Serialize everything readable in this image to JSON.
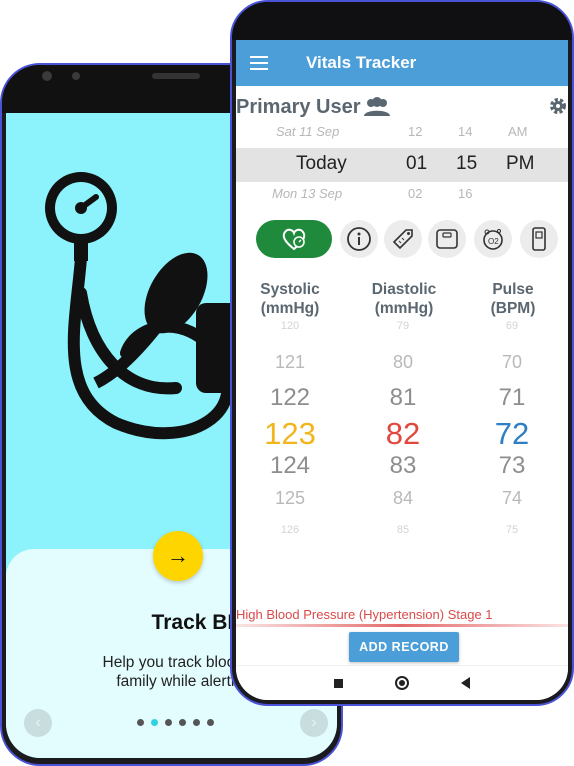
{
  "onboarding": {
    "next_glyph": "→",
    "title": "Track BP",
    "description_line1": "Help you track blood pressure",
    "description_line2": "family while alerting about",
    "prev_glyph": "‹",
    "forward_glyph": "›",
    "page_count": 6,
    "active_page": 2
  },
  "app": {
    "title": "Vitals Tracker",
    "user_name": "Primary User",
    "date_picker": {
      "prev": {
        "day": "Sat 11 Sep",
        "hour": "12",
        "minute": "14",
        "ampm": "AM"
      },
      "selected": {
        "day": "Today",
        "hour": "01",
        "minute": "15",
        "ampm": "PM"
      },
      "next": {
        "day": "Mon 13 Sep",
        "hour": "02",
        "minute": "16"
      }
    },
    "columns": {
      "systolic": {
        "label": "Systolic",
        "unit": "(mmHg)",
        "values": [
          "120",
          "121",
          "122",
          "123",
          "124",
          "125",
          "126"
        ],
        "color": "#f2b51c"
      },
      "diastolic": {
        "label": "Diastolic",
        "unit": "(mmHg)",
        "values": [
          "79",
          "80",
          "81",
          "82",
          "83",
          "84",
          "85"
        ],
        "color": "#e0483c"
      },
      "pulse": {
        "label": "Pulse",
        "unit": "(BPM)",
        "values": [
          "69",
          "70",
          "71",
          "72",
          "73",
          "74",
          "75"
        ],
        "color": "#2f7fc4"
      }
    },
    "status": "High Blood Pressure (Hypertension) Stage 1",
    "add_button": "ADD RECORD",
    "vital_icons": [
      "heart-pressure-icon",
      "info-icon",
      "tag-icon",
      "scale-icon",
      "oxygen-icon",
      "glucose-meter-icon"
    ]
  }
}
